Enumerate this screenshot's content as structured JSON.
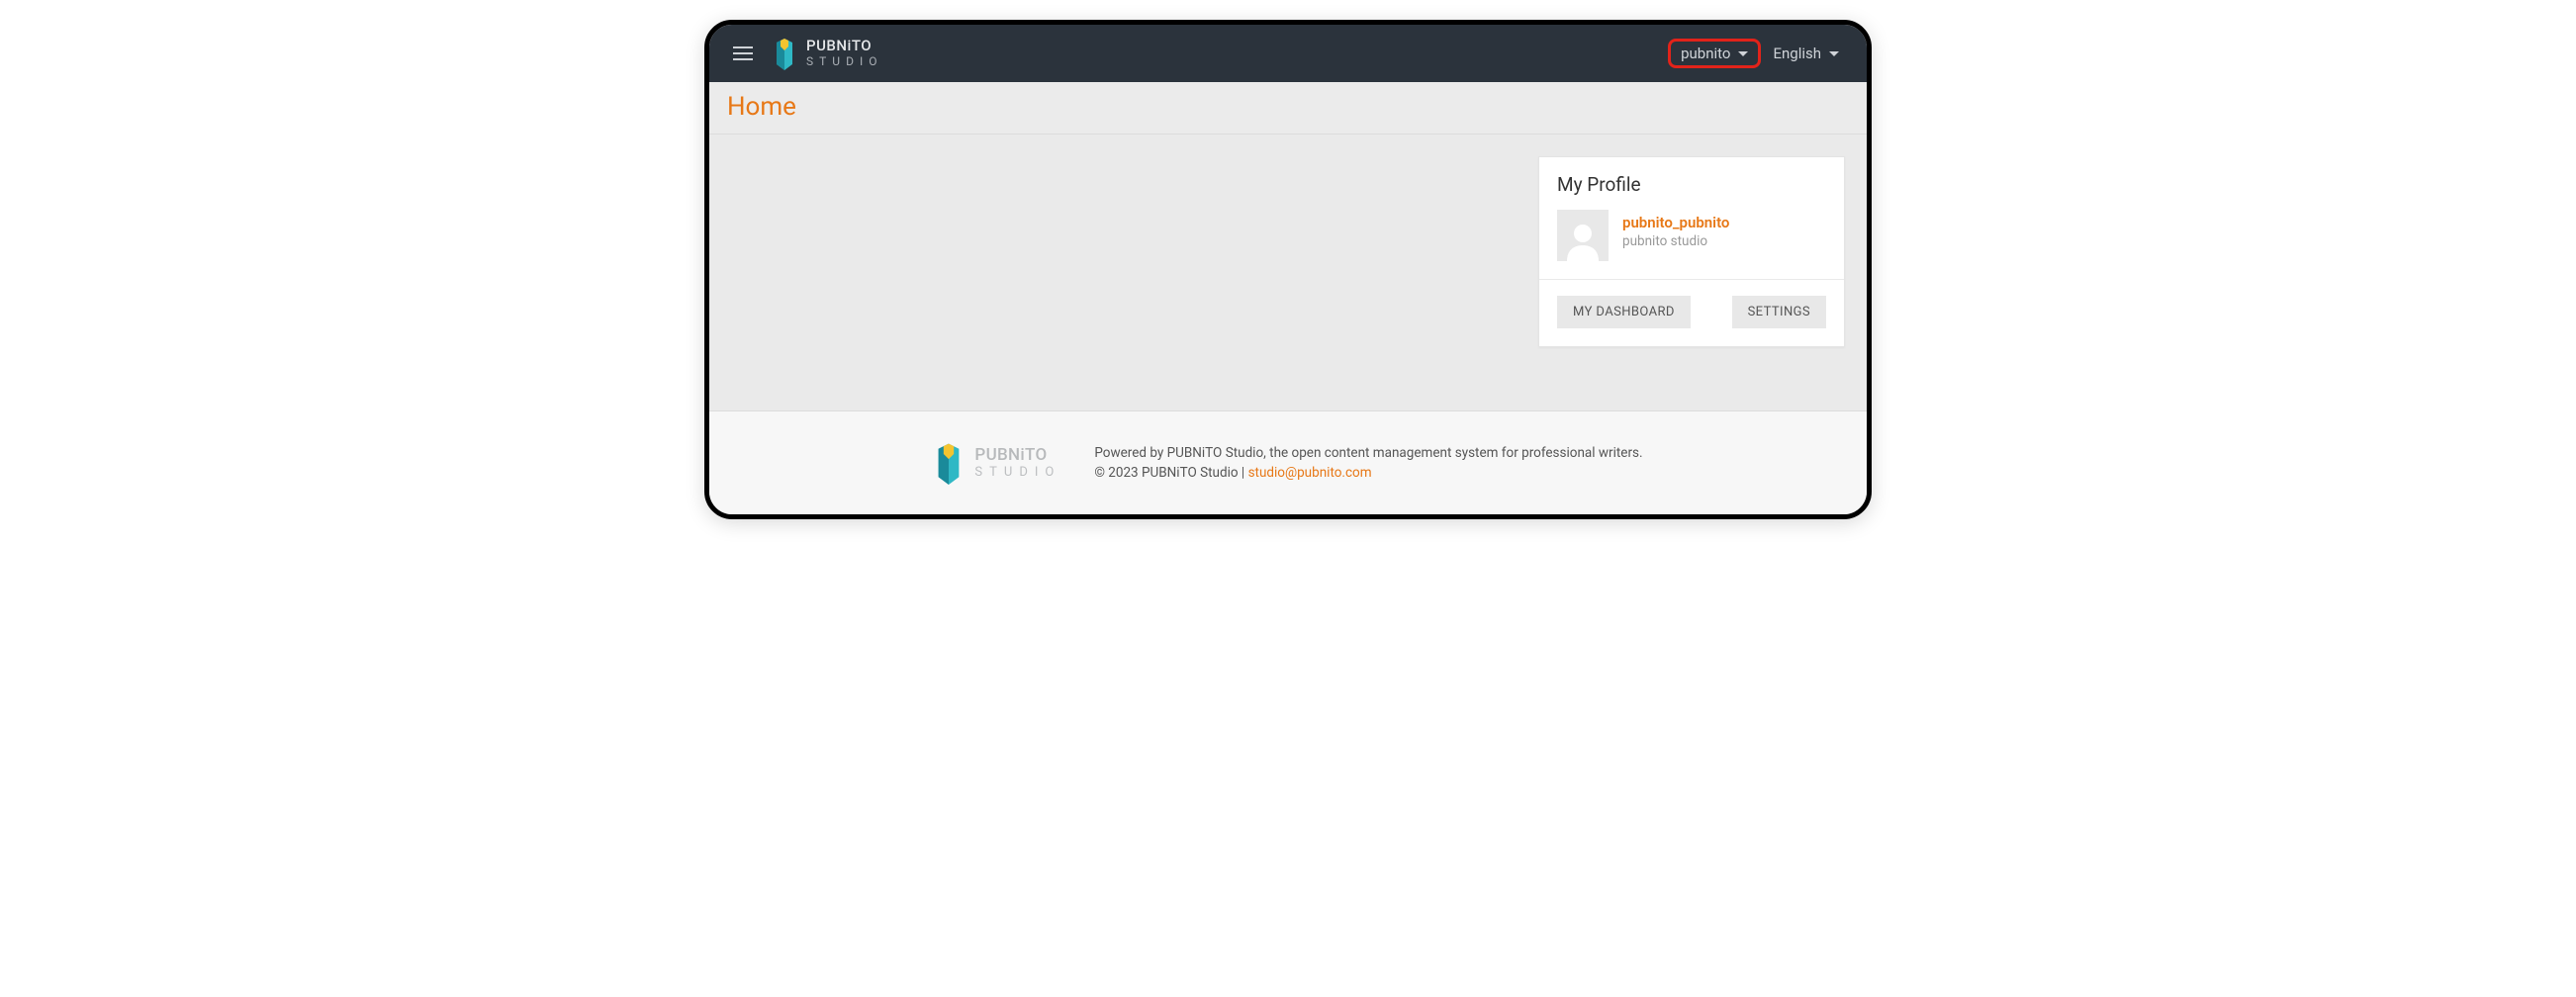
{
  "header": {
    "brand_name": "PUBNiTO",
    "brand_sub": "STUDIO",
    "user_dropdown": "pubnito",
    "language_dropdown": "English"
  },
  "page": {
    "title": "Home"
  },
  "profile": {
    "card_title": "My Profile",
    "username": "pubnito_pubnito",
    "org": "pubnito studio",
    "dashboard_btn": "MY DASHBOARD",
    "settings_btn": "SETTINGS"
  },
  "footer": {
    "brand_name": "PUBNiTO",
    "brand_sub": "STUDIO",
    "tagline": "Powered by PUBNiTO Studio, the open content management system for professional writers.",
    "copyright_prefix": "© 2023 PUBNiTO Studio | ",
    "email": "studio@pubnito.com"
  }
}
